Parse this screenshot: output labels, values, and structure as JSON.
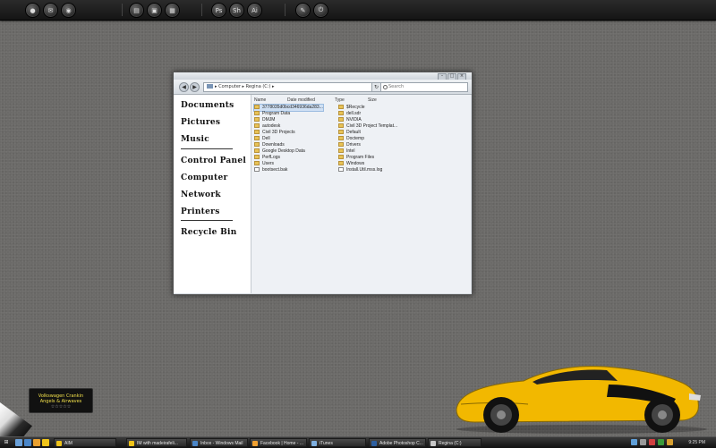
{
  "dock": {
    "group1": [
      "AIM",
      "Mail",
      "Chrome"
    ],
    "group2": [
      "Docs",
      "Pics",
      "Net"
    ],
    "group3": [
      "Ps",
      "Sh",
      "Ai"
    ],
    "group4": [
      "Edit",
      "Quit"
    ]
  },
  "explorer": {
    "address": "▸ Computer ▸ Regina (C:) ▸",
    "refresh_icon": "↻",
    "search_placeholder": "Search",
    "columns": [
      "Name",
      "Date modified",
      "Type",
      "Size"
    ],
    "sidebar": [
      "Documents",
      "Pictures",
      "Music",
      "Control Panel",
      "Computer",
      "Network",
      "Printers",
      "Recycle Bin"
    ],
    "files_col1": [
      {
        "name": "3778035d0bcd346936da283...",
        "type": "folder",
        "selected": true
      },
      {
        "name": "Program Data",
        "type": "folder"
      },
      {
        "name": "DMJM",
        "type": "folder"
      },
      {
        "name": "autodesk",
        "type": "folder"
      },
      {
        "name": "Civil 3D Projects",
        "type": "folder"
      },
      {
        "name": "Dell",
        "type": "folder"
      },
      {
        "name": "Downloads",
        "type": "folder"
      },
      {
        "name": "Google Desktop Data",
        "type": "folder"
      },
      {
        "name": "PerfLogs",
        "type": "folder"
      },
      {
        "name": "Users",
        "type": "folder"
      },
      {
        "name": "bootsect.bak",
        "type": "file"
      }
    ],
    "files_col2": [
      {
        "name": "$Recycle",
        "type": "folder"
      },
      {
        "name": "dell.sdr",
        "type": "folder"
      },
      {
        "name": "NVIDIA",
        "type": "folder"
      },
      {
        "name": "Civil 3D Project Templat...",
        "type": "folder"
      },
      {
        "name": "Default",
        "type": "folder"
      },
      {
        "name": "Doctemp",
        "type": "folder"
      },
      {
        "name": "Drivers",
        "type": "folder"
      },
      {
        "name": "Intel",
        "type": "folder"
      },
      {
        "name": "Program Files",
        "type": "folder"
      },
      {
        "name": "Windows",
        "type": "folder"
      },
      {
        "name": "Install.Util.mss.log",
        "type": "file"
      }
    ]
  },
  "widget": {
    "line1": "Volkswagen Crankin",
    "line2": "Angels & Airwaves",
    "stars": "☆☆☆☆☆"
  },
  "taskbar": {
    "start": "⊞",
    "tasks": [
      {
        "label": "AIM",
        "color": "#f0c419"
      },
      {
        "label": "IM with madeirafeli...",
        "color": "#f0c419"
      },
      {
        "label": "Inbox - Windows Mail",
        "color": "#4a86c8"
      },
      {
        "label": "Facebook | Home - ...",
        "color": "#f0a030"
      },
      {
        "label": "iTunes",
        "color": "#7fb0e0"
      },
      {
        "label": "Adobe Photoshop C...",
        "color": "#2d5fa0"
      },
      {
        "label": "Regina (C:)",
        "color": "#c8c8c8"
      }
    ],
    "clock": "9:25 PM"
  },
  "colors": {
    "car_body": "#f2b800",
    "desktop": "#6b6a68",
    "accent_folder": "#e8c356"
  }
}
